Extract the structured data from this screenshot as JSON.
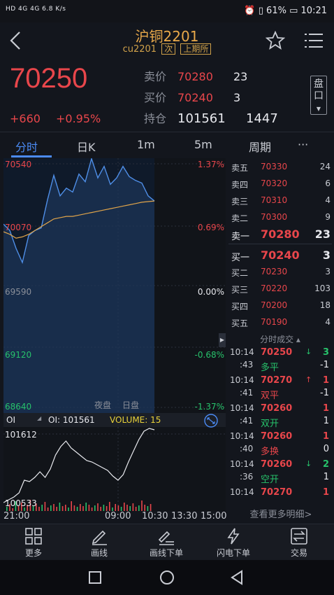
{
  "status_bar": {
    "left": "HD 4G 4G 6.8 K/s",
    "battery": "61%",
    "time": "10:21"
  },
  "header": {
    "title": "沪铜2201",
    "code": "cu2201",
    "tag_next": "次",
    "tag_exchange": "上期所"
  },
  "quote": {
    "last_price": "70250",
    "change": "+660",
    "change_pct": "+0.95%",
    "ask_label": "卖价",
    "ask_price": "70280",
    "ask_vol": "23",
    "bid_label": "买价",
    "bid_price": "70240",
    "bid_vol": "3",
    "oi_label": "持仓",
    "oi_value": "101561",
    "oi_change": "1447",
    "panko": "盘口"
  },
  "tabs": [
    {
      "label": "分时",
      "active": true
    },
    {
      "label": "日K"
    },
    {
      "label": "1m"
    },
    {
      "label": "5m"
    },
    {
      "label": "周期"
    },
    {
      "label": "···"
    }
  ],
  "chart": {
    "price_ticks": [
      "70540",
      "70070",
      "69590",
      "69120",
      "68640"
    ],
    "pct_ticks": [
      "1.37%",
      "0.69%",
      "0.00%",
      "-0.68%",
      "-1.37%"
    ],
    "session_night": "夜盘",
    "session_day": "日盘",
    "legend_oi_label": "OI",
    "legend_oi": "OI: 101561",
    "legend_volume": "VOLUME: 15",
    "oi_high": "101612",
    "oi_low": "100533",
    "x_ticks": [
      "21:00",
      "09:00",
      "10:30",
      "13:30",
      "15:00"
    ]
  },
  "chart_data": {
    "type": "line",
    "title": "",
    "ylim": [
      68640,
      70540
    ],
    "series": [
      {
        "values": [
          70070,
          70020,
          69880,
          69770,
          69980,
          70020,
          70040,
          70260,
          70450,
          70290,
          70350,
          70320,
          70460,
          70400,
          70580,
          70430,
          70520,
          70380,
          70430,
          70520,
          70440,
          70410,
          70390,
          70290,
          70250
        ]
      },
      {
        "values": [
          70010,
          69990,
          69960,
          69970,
          69990,
          70020,
          70050,
          70080,
          70110,
          70120,
          70130,
          70130,
          70140,
          70150,
          70160,
          70170,
          70180,
          70190,
          70200,
          70210,
          70220,
          70230,
          70240,
          70245,
          70250
        ]
      }
    ]
  },
  "orderbook": {
    "asks": [
      {
        "label": "卖五",
        "price": "70330",
        "vol": "24"
      },
      {
        "label": "卖四",
        "price": "70320",
        "vol": "6"
      },
      {
        "label": "卖三",
        "price": "70310",
        "vol": "4"
      },
      {
        "label": "卖二",
        "price": "70300",
        "vol": "9"
      },
      {
        "label": "卖一",
        "price": "70280",
        "vol": "23"
      }
    ],
    "bids": [
      {
        "label": "买一",
        "price": "70240",
        "vol": "3"
      },
      {
        "label": "买二",
        "price": "70230",
        "vol": "3"
      },
      {
        "label": "买三",
        "price": "70220",
        "vol": "103"
      },
      {
        "label": "买四",
        "price": "70200",
        "vol": "18"
      },
      {
        "label": "买五",
        "price": "70190",
        "vol": "4"
      }
    ]
  },
  "trades": {
    "header": "分时成交",
    "rows": [
      {
        "time": "10:14",
        "sec": ":43",
        "price": "70250",
        "arrow": "↓",
        "vol": "3",
        "type": "多平",
        "oi": "-1",
        "type_color": "green",
        "arrow_color": "green",
        "vol_color": "green"
      },
      {
        "time": "10:14",
        "sec": ":41",
        "price": "70270",
        "arrow": "↑",
        "vol": "1",
        "type": "双平",
        "oi": "-1",
        "type_color": "red",
        "arrow_color": "red",
        "vol_color": "red"
      },
      {
        "time": "10:14",
        "sec": ":41",
        "price": "70260",
        "arrow": "",
        "vol": "1",
        "type": "双开",
        "oi": "1",
        "type_color": "green",
        "arrow_color": "",
        "vol_color": "red"
      },
      {
        "time": "10:14",
        "sec": ":40",
        "price": "70260",
        "arrow": "",
        "vol": "1",
        "type": "多换",
        "oi": "0",
        "type_color": "red",
        "arrow_color": "",
        "vol_color": "red"
      },
      {
        "time": "10:14",
        "sec": ":36",
        "price": "70260",
        "arrow": "↓",
        "vol": "2",
        "type": "空开",
        "oi": "1",
        "type_color": "green",
        "arrow_color": "green",
        "vol_color": "green"
      },
      {
        "time": "10:14",
        "sec": "",
        "price": "70270",
        "arrow": "",
        "vol": "1",
        "type": "",
        "oi": "",
        "type_color": "red",
        "arrow_color": "",
        "vol_color": "red"
      }
    ],
    "more": "查看更多明细>"
  },
  "toolbar": {
    "more": "更多",
    "draw": "画线",
    "draw_order": "画线下单",
    "flash_order": "闪电下单",
    "trade": "交易"
  }
}
